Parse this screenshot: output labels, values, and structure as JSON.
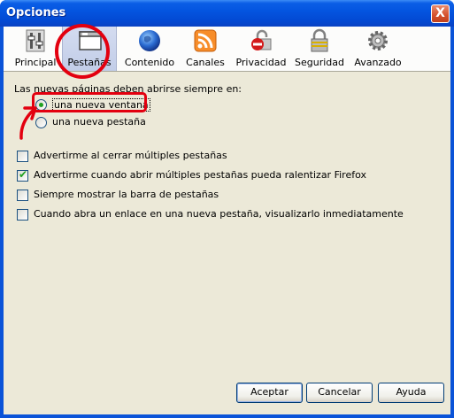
{
  "window": {
    "title": "Opciones",
    "close_label": "X"
  },
  "tabs": [
    {
      "label": "Principal",
      "icon": "switches-icon"
    },
    {
      "label": "Pestañas",
      "icon": "tab-window-icon"
    },
    {
      "label": "Contenido",
      "icon": "globe-icon"
    },
    {
      "label": "Canales",
      "icon": "rss-feed-icon"
    },
    {
      "label": "Privacidad",
      "icon": "no-entry-icon"
    },
    {
      "label": "Seguridad",
      "icon": "padlock-icon"
    },
    {
      "label": "Avanzado",
      "icon": "gear-icon"
    }
  ],
  "selected_tab": "Pestañas",
  "new_pages": {
    "label": "Las nuevas páginas deben abrirse siempre en:",
    "options": [
      {
        "label": "una nueva ventana",
        "selected": true
      },
      {
        "label": "una nueva pestaña",
        "selected": false
      }
    ]
  },
  "checkboxes": [
    {
      "label": "Advertirme al cerrar múltiples pestañas",
      "checked": false
    },
    {
      "label": "Advertirme cuando abrir múltiples pestañas pueda ralentizar Firefox",
      "checked": true
    },
    {
      "label": "Siempre mostrar la barra de pestañas",
      "checked": false
    },
    {
      "label": "Cuando abra un enlace en una nueva pestaña, visualizarlo inmediatamente",
      "checked": false
    }
  ],
  "buttons": {
    "accept": "Aceptar",
    "cancel": "Cancelar",
    "help": "Ayuda"
  },
  "colors": {
    "titlebar": "#0455e0",
    "dialog_bg": "#ece9d8",
    "annotation": "#e3000f",
    "check": "#21a121"
  }
}
